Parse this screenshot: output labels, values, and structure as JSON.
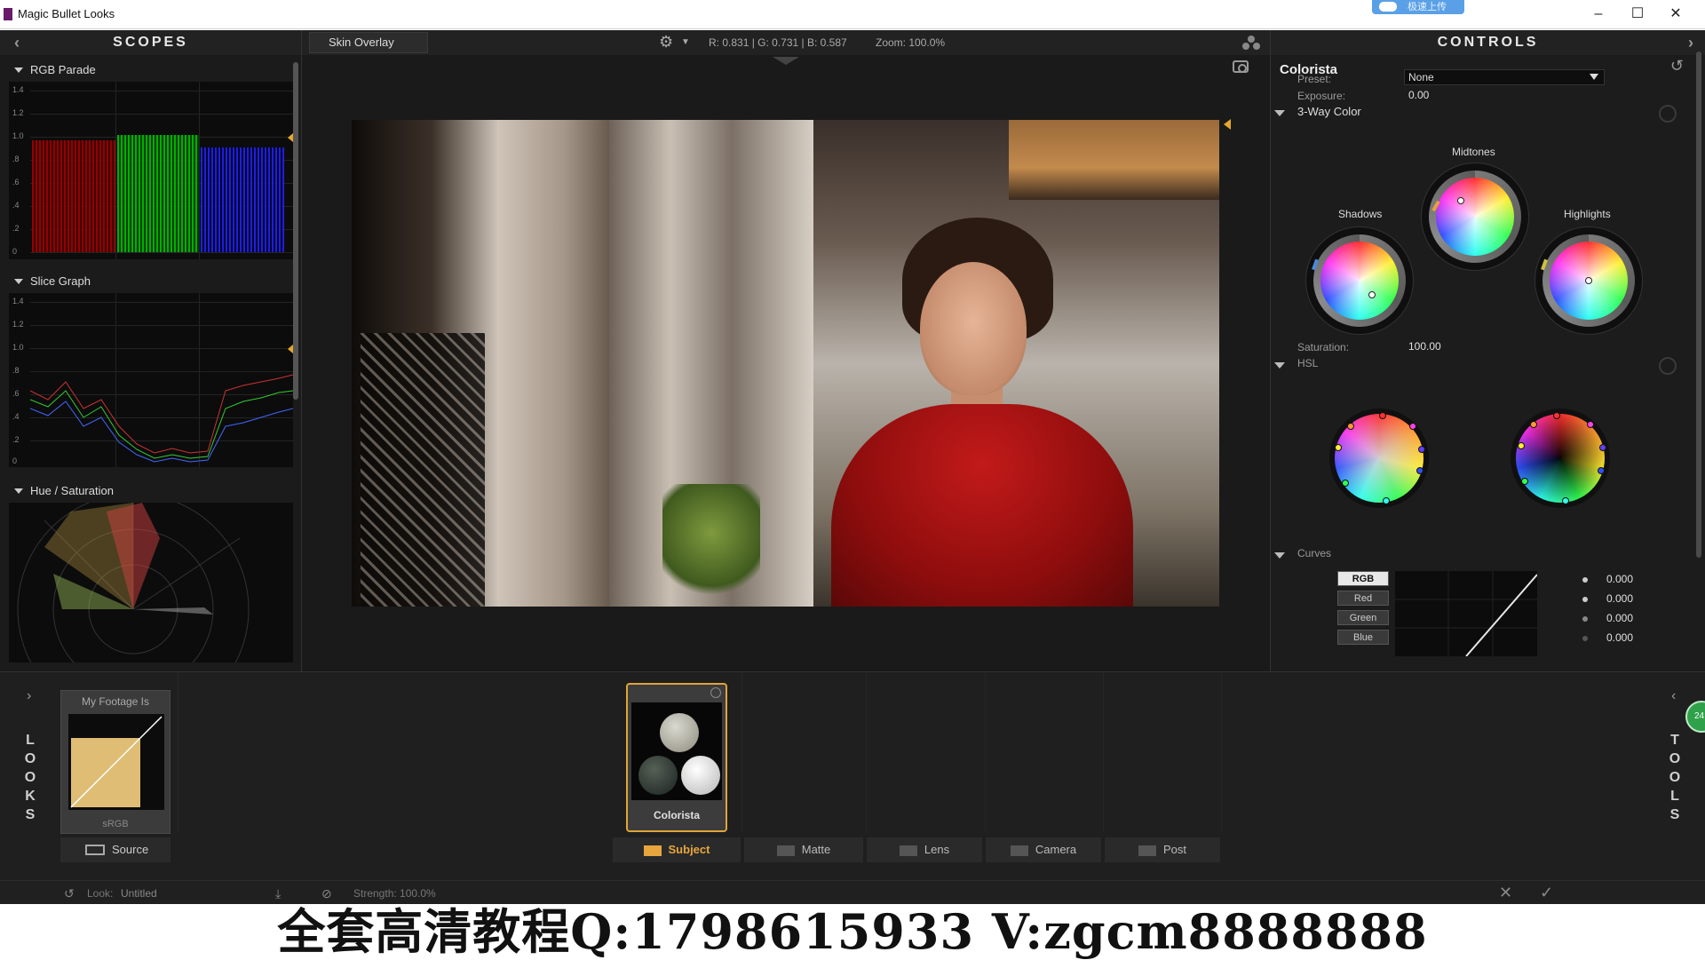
{
  "window": {
    "title": "Magic Bullet Looks",
    "upload_tag": "极速上传",
    "minimize": "–",
    "maximize": "☐",
    "close": "✕"
  },
  "scopes": {
    "title": "SCOPES",
    "collapse_arrow": "‹",
    "sections": [
      {
        "label": "RGB Parade",
        "ticks": [
          "1.4",
          "1.2",
          "1.0",
          ".8",
          ".6",
          ".4",
          ".2",
          "0"
        ]
      },
      {
        "label": "Slice Graph",
        "ticks": [
          "1.4",
          "1.2",
          "1.0",
          ".8",
          ".6",
          ".4",
          ".2",
          "0"
        ]
      },
      {
        "label": "Hue / Saturation"
      }
    ]
  },
  "viewer": {
    "skin_overlay": "Skin Overlay",
    "rgb_readout": "R: 0.831 | G: 0.731 | B: 0.587",
    "zoom_readout": "Zoom: 100.0%"
  },
  "controls": {
    "title": "CONTROLS",
    "tool_name": "Colorista",
    "preset_label": "Preset:",
    "preset_value": "None",
    "exposure_label": "Exposure:",
    "exposure_value": "0.00",
    "three_way_label": "3-Way Color",
    "midtones_label": "Midtones",
    "shadows_label": "Shadows",
    "highlights_label": "Highlights",
    "saturation_label": "Saturation:",
    "saturation_value": "100.00",
    "hsl_label": "HSL",
    "curves_label": "Curves",
    "curve_buttons": [
      "RGB",
      "Red",
      "Green",
      "Blue"
    ],
    "curve_values": [
      "0.000",
      "0.000",
      "0.000",
      "0.000"
    ]
  },
  "looks": {
    "left_label": [
      "L",
      "O",
      "O",
      "K",
      "S"
    ],
    "right_label": [
      "T",
      "O",
      "O",
      "L",
      "S"
    ],
    "footage_title": "My Footage Is",
    "footage_sub": "sRGB",
    "source_label": "Source",
    "colorista_card": "Colorista",
    "badge": "24",
    "tabs": [
      "Subject",
      "Matte",
      "Lens",
      "Camera",
      "Post"
    ]
  },
  "status": {
    "look_label": "Look:",
    "look_value": "Untitled",
    "strength": "Strength: 100.0%"
  },
  "watermark": "全套高清教程Q:1798615933 V:zgcm8888888",
  "colors": {
    "accent": "#e7a63d",
    "panel_bg": "#1c1c1c"
  }
}
